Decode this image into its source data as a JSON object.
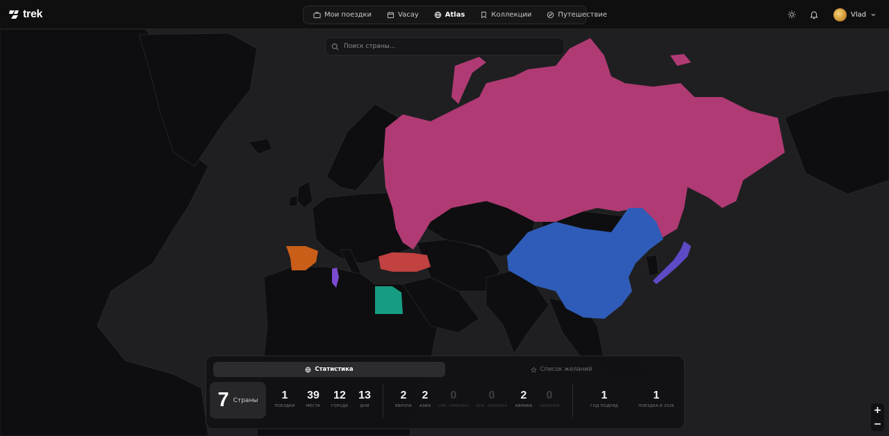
{
  "app": {
    "name": "trek"
  },
  "nav": {
    "items": [
      {
        "label": "Мои поездки",
        "icon": "briefcase-icon",
        "active": false
      },
      {
        "label": "Vacay",
        "icon": "calendar-icon",
        "active": false
      },
      {
        "label": "Atlas",
        "icon": "globe-icon",
        "active": true
      },
      {
        "label": "Коллекции",
        "icon": "bookmark-icon",
        "active": false
      },
      {
        "label": "Путешествие",
        "icon": "compass-icon",
        "active": false
      }
    ]
  },
  "header": {
    "user_name": "Vlad",
    "theme_icon": "sun-icon",
    "notifications_icon": "bell-icon"
  },
  "search": {
    "placeholder": "Поиск страны..."
  },
  "map": {
    "visited_countries": [
      {
        "name": "Russia",
        "color": "#b03a74"
      },
      {
        "name": "China",
        "color": "#2f5cb8"
      },
      {
        "name": "Japan",
        "color": "#5b4bc4"
      },
      {
        "name": "Spain",
        "color": "#c95e18"
      },
      {
        "name": "Turkey",
        "color": "#c24141"
      },
      {
        "name": "Egypt",
        "color": "#169c82"
      },
      {
        "name": "Tunisia",
        "color": "#7b4bd0"
      }
    ],
    "zoom_in": "+",
    "zoom_out": "−"
  },
  "stats": {
    "tabs": [
      {
        "label": "Статистика",
        "icon": "globe-icon",
        "active": true
      },
      {
        "label": "Список желаний",
        "icon": "star-icon",
        "active": false
      }
    ],
    "countries": {
      "value": "7",
      "label": "Страны"
    },
    "items": [
      {
        "value": "1",
        "label": "поездки"
      },
      {
        "value": "39",
        "label": "места"
      },
      {
        "value": "12",
        "label": "города"
      },
      {
        "value": "13",
        "label": "дни"
      },
      {
        "value": "2",
        "label": "европа"
      },
      {
        "value": "2",
        "label": "азия"
      },
      {
        "value": "0",
        "label": "сев. америка"
      },
      {
        "value": "0",
        "label": "юж. америка"
      },
      {
        "value": "2",
        "label": "африка"
      },
      {
        "value": "0",
        "label": "океания"
      },
      {
        "value": "1",
        "label": "год подряд"
      },
      {
        "value": "1",
        "label": "поездка в 2026"
      }
    ]
  }
}
